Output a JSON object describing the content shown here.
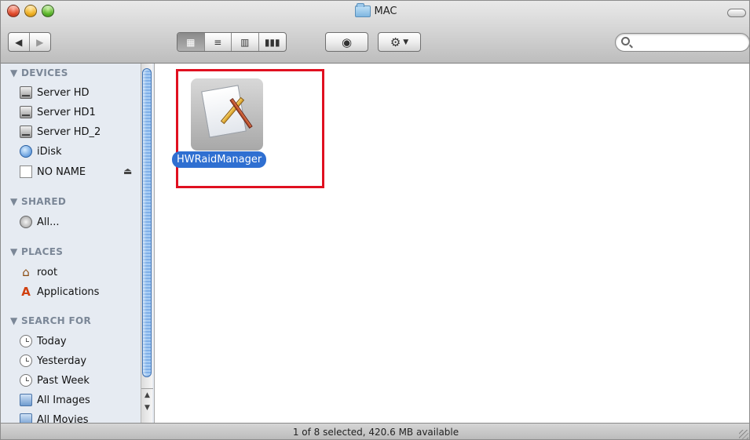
{
  "window": {
    "title": "MAC"
  },
  "toolbar": {
    "back_icon": "back-arrow-icon",
    "forward_icon": "forward-arrow-icon",
    "view_modes": [
      "icon-view",
      "list-view",
      "column-view",
      "cover-flow-view"
    ],
    "active_view": "icon-view",
    "quicklook_icon": "eye-icon",
    "action_icon": "gear-icon",
    "search_placeholder": ""
  },
  "sidebar": {
    "devices": {
      "heading": "▼ DEVICES",
      "items": [
        "Server HD",
        "Server HD1",
        "Server HD_2",
        "iDisk",
        "NO NAME"
      ]
    },
    "shared": {
      "heading": "▼ SHARED",
      "items": [
        "All..."
      ]
    },
    "places": {
      "heading": "▼ PLACES",
      "items": [
        "root",
        "Applications"
      ]
    },
    "search_for": {
      "heading": "▼ SEARCH FOR",
      "items": [
        "Today",
        "Yesterday",
        "Past Week",
        "All Images",
        "All Movies"
      ]
    }
  },
  "content": {
    "selected_file": "HWRaidManager"
  },
  "status": {
    "text": "1 of 8 selected, 420.6 MB available"
  },
  "colors": {
    "selection": "#2f6fd1",
    "highlight_box": "#e01020",
    "sidebar_bg": "#e6ebf2"
  }
}
